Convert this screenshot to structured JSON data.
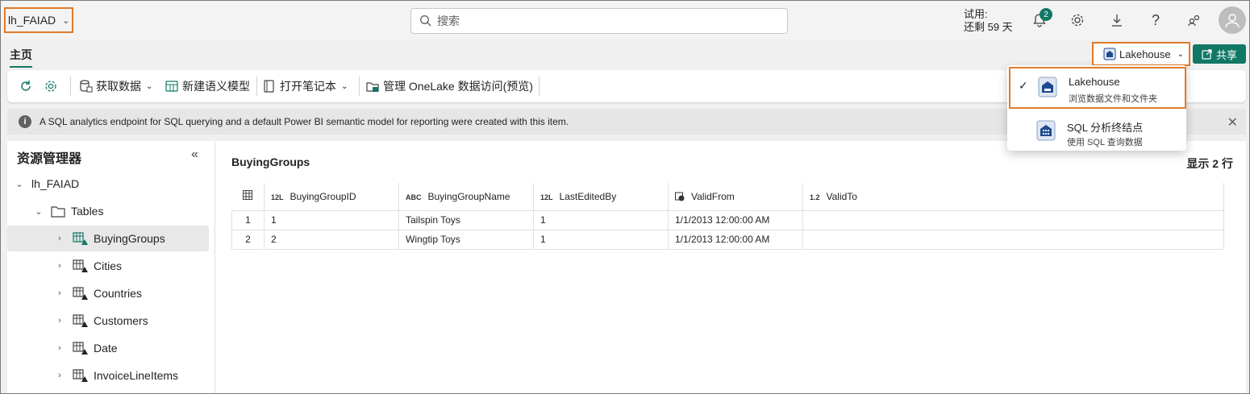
{
  "workspace": {
    "name": "lh_FAIAD"
  },
  "search": {
    "placeholder": "搜索"
  },
  "trial": {
    "line1": "试用:",
    "line2": "还剩 59 天"
  },
  "notifications": {
    "count": "2"
  },
  "tabs": {
    "home": "主页"
  },
  "view_switch": {
    "label": "Lakehouse"
  },
  "share": {
    "label": "共享"
  },
  "ribbon": {
    "get_data": "获取数据",
    "new_semantic_model": "新建语义模型",
    "open_notebook": "打开笔记本",
    "manage_onelake": "管理 OneLake 数据访问(预览)"
  },
  "info": {
    "message": "A SQL analytics endpoint for SQL querying and a default Power BI semantic model for reporting were created with this item."
  },
  "explorer": {
    "title": "资源管理器",
    "root": "lh_FAIAD",
    "folder": "Tables",
    "tables": [
      "BuyingGroups",
      "Cities",
      "Countries",
      "Customers",
      "Date",
      "InvoiceLineItems"
    ]
  },
  "table_view": {
    "title": "BuyingGroups",
    "row_count": "显示 2 行",
    "columns": [
      {
        "type": "12L",
        "name": "BuyingGroupID"
      },
      {
        "type": "ABC",
        "name": "BuyingGroupName"
      },
      {
        "type": "12L",
        "name": "LastEditedBy"
      },
      {
        "type": "clock",
        "name": "ValidFrom"
      },
      {
        "type": "1.2",
        "name": "ValidTo"
      }
    ],
    "rows": [
      [
        "1",
        "1",
        "Tailspin Toys",
        "1",
        "1/1/2013 12:00:00 AM",
        ""
      ],
      [
        "2",
        "2",
        "Wingtip Toys",
        "1",
        "1/1/2013 12:00:00 AM",
        ""
      ]
    ]
  },
  "dropdown": {
    "items": [
      {
        "name": "Lakehouse",
        "sub": "浏览数据文件和文件夹",
        "checked": true
      },
      {
        "name": "SQL 分析终结点",
        "sub": "使用 SQL 查询数据",
        "checked": false
      }
    ]
  },
  "colors": {
    "accent": "#117865",
    "highlight": "#e07b2a",
    "lakehouse_icon": "#1e4b8f"
  }
}
